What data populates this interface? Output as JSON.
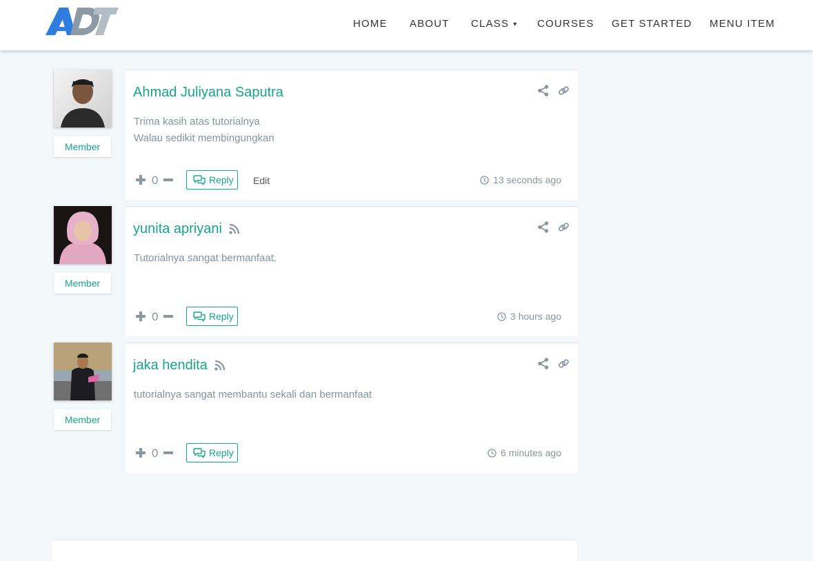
{
  "header": {
    "nav": [
      "HOME",
      "ABOUT",
      "CLASS",
      "COURSES",
      "GET STARTED",
      "MENU ITEM"
    ],
    "class_caret": "▾"
  },
  "colors": {
    "accent": "#17a589",
    "background": "#f2f7fa"
  },
  "comments": [
    {
      "author": "Ahmad Juliyana Saputra",
      "role": "Member",
      "lines": [
        "Trima kasih atas tutorialnya",
        "Walau sedikit membingungkan"
      ],
      "votes": "0",
      "reply_label": "Reply",
      "edit_label": "Edit",
      "time": "13 seconds ago",
      "rss": false
    },
    {
      "author": "yunita apriyani",
      "role": "Member",
      "lines": [
        "Tutorialnya sangat bermanfaat."
      ],
      "votes": "0",
      "reply_label": "Reply",
      "time": "3 hours ago",
      "rss": true
    },
    {
      "author": "jaka hendita",
      "role": "Member",
      "lines": [
        "tutorialnya sangat membantu sekali dan bermanfaat"
      ],
      "votes": "0",
      "reply_label": "Reply",
      "time": "6 minutes ago",
      "rss": true
    }
  ]
}
